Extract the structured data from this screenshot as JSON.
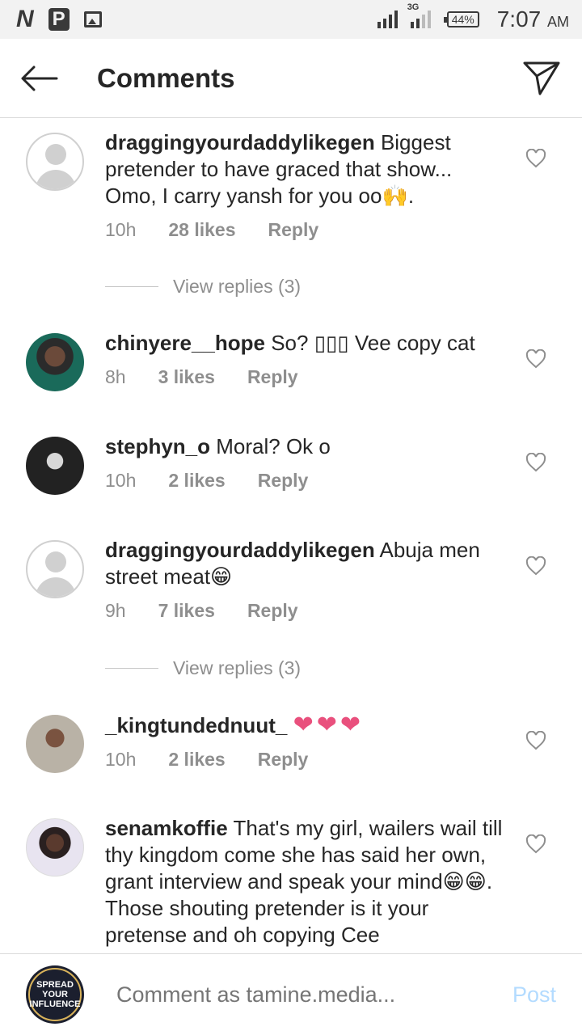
{
  "status_bar": {
    "left_icons": [
      "N",
      "P",
      "image-icon"
    ],
    "network": "3G",
    "battery": "44%",
    "time": "7:07",
    "ampm": "AM"
  },
  "header": {
    "title": "Comments"
  },
  "comments": [
    {
      "username": "draggingyourdaddylikegen",
      "text": " Biggest pretender to have graced that show... Omo, I carry yansh for you oo🙌.",
      "time": "10h",
      "likes": "28 likes",
      "reply": "Reply",
      "view_replies": "View replies (3)",
      "avatar": "default"
    },
    {
      "username": "chinyere__hope",
      "text": " So? ▯▯▯ Vee copy cat",
      "time": "8h",
      "likes": "3 likes",
      "reply": "Reply",
      "avatar": "photo"
    },
    {
      "username": "stephyn_o",
      "text": " Moral? Ok o",
      "time": "10h",
      "likes": "2 likes",
      "reply": "Reply",
      "avatar": "photo"
    },
    {
      "username": "draggingyourdaddylikegen",
      "text": " Abuja men street meat😁",
      "time": "9h",
      "likes": "7 likes",
      "reply": "Reply",
      "view_replies": "View replies (3)",
      "avatar": "default"
    },
    {
      "username": "_kingtundednuut_",
      "text": "❤❤❤",
      "time": "10h",
      "likes": "2 likes",
      "reply": "Reply",
      "avatar": "photo"
    },
    {
      "username": "senamkoffie",
      "text": " That's my girl, wailers wail till thy kingdom come she has said her own, grant interview and speak your mind😁😁. Those shouting pretender is it your pretense and oh copying Cee",
      "avatar": "photo"
    }
  ],
  "composer": {
    "placeholder": "Comment as tamine.media...",
    "post_label": "Post",
    "avatar_text": "SPREAD YOUR INFLUENCE"
  },
  "colors": {
    "heart": "#e9507d",
    "post_disabled": "#b3dbff",
    "meta": "#8e8e8e"
  }
}
